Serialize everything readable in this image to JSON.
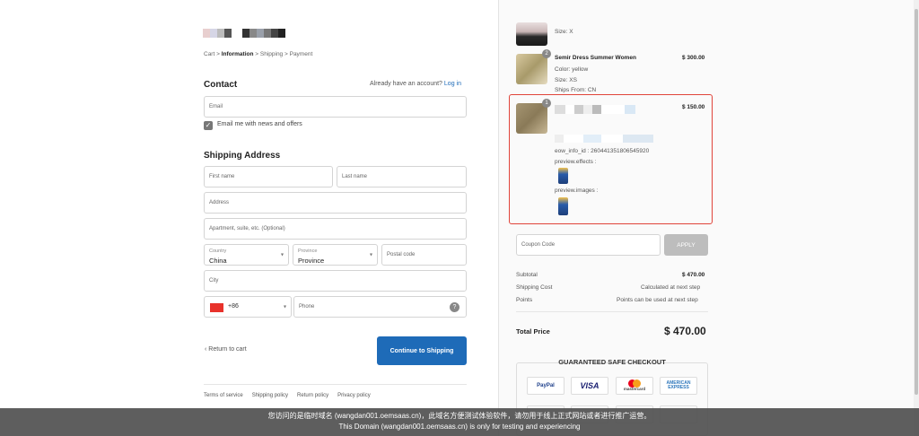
{
  "breadcrumb": {
    "cart": "Cart",
    "sep": ">",
    "information": "Information",
    "shipping": "Shipping",
    "payment": "Payment"
  },
  "contact": {
    "title": "Contact",
    "have_account": "Already have an account?",
    "login": "Log in",
    "email_placeholder": "Email",
    "newsletter": "Email me with news and offers"
  },
  "shipping": {
    "title": "Shipping Address",
    "first_name": "First name",
    "last_name": "Last name",
    "address": "Address",
    "apartment": "Apartment, suite, etc. (Optional)",
    "country_label": "Country",
    "country_value": "China",
    "province_label": "Province",
    "province_value": "Province",
    "postal": "Postal code",
    "city": "City",
    "phone_code": "+86",
    "phone": "Phone"
  },
  "actions": {
    "return": "Return to cart",
    "continue": "Continue to Shipping"
  },
  "footer": [
    "Terms of service",
    "Shipping policy",
    "Return policy",
    "Privacy policy"
  ],
  "order": {
    "item0": {
      "size": "Size: X"
    },
    "item1": {
      "qty": "2",
      "name": "Semir Dress Summer Women",
      "price": "$ 300.00",
      "color": "Color: yellow",
      "size": "Size: XS",
      "ships": "Ships From: CN"
    },
    "item2": {
      "qty": "1",
      "price": "$ 150.00",
      "info_id": "eow_info_id : 260441351806545920",
      "effects": "preview.effects :",
      "images": "preview.images :"
    }
  },
  "coupon": {
    "placeholder": "Coupon Code",
    "apply": "APPLY"
  },
  "summary": {
    "subtotal_label": "Subtotal",
    "subtotal": "$ 470.00",
    "shipping_label": "Shipping Cost",
    "shipping": "Calculated at next step",
    "points_label": "Points",
    "points": "Points can be used at next step",
    "total_label": "Total Price",
    "total": "$ 470.00"
  },
  "guarantee": {
    "title": "GUARANTEED SAFE CHECKOUT",
    "paypal": "PayPal",
    "visa": "VISA",
    "mastercard": "mastercard",
    "amex": "AMERICAN EXPRESS"
  },
  "notice": {
    "line1": "您访问的是临时域名 (wangdan001.oemsaas.cn)，此域名方便测试体验软件，请勿用于线上正式网站或者进行推广运营。",
    "line2": "This Domain (wangdan001.oemsaas.cn) is only for testing and experiencing"
  },
  "colors": {
    "accent": "#1e6bb8",
    "highlight": "#e0443a"
  }
}
